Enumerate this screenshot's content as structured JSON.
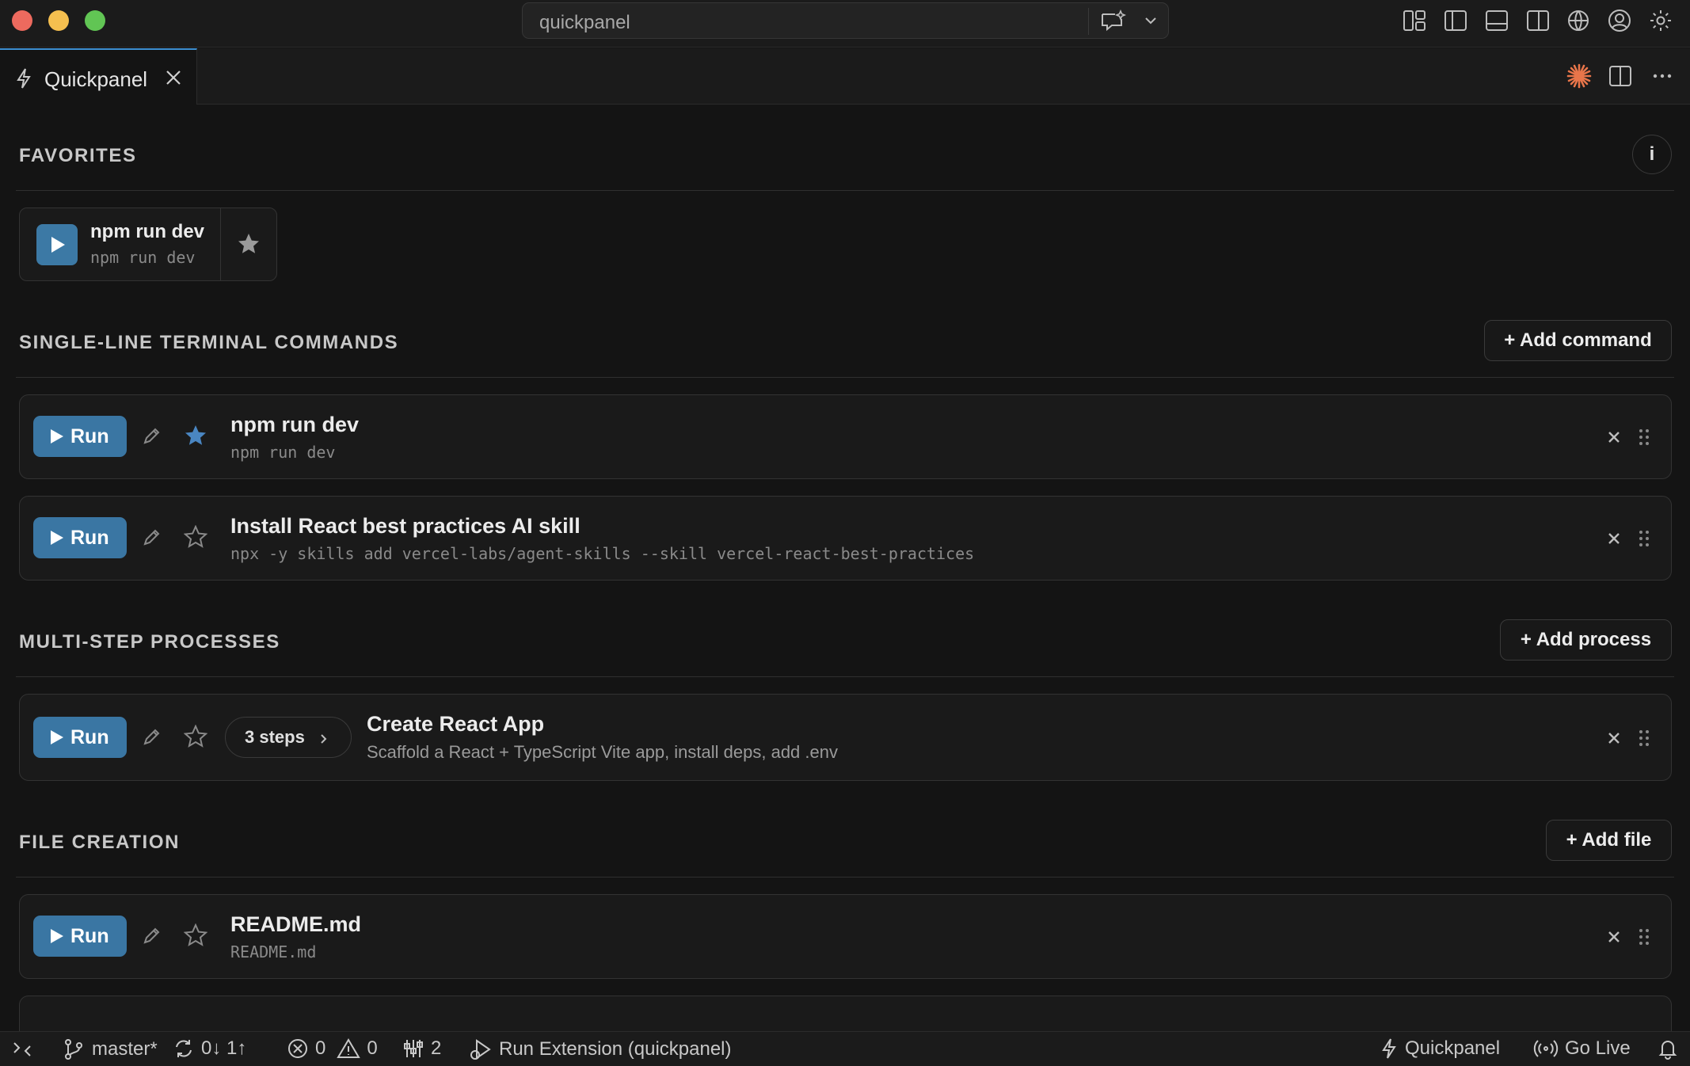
{
  "window": {
    "search_text": "quickpanel"
  },
  "tab": {
    "label": "Quickpanel"
  },
  "favorites": {
    "title": "FAVORITES",
    "info_label": "i",
    "items": [
      {
        "name": "npm run dev",
        "command": "npm run dev"
      }
    ]
  },
  "single_line": {
    "title": "SINGLE-LINE TERMINAL COMMANDS",
    "add_label": "+ Add command",
    "items": [
      {
        "run_label": "Run",
        "name": "npm run dev",
        "command": "npm run dev",
        "starred": true
      },
      {
        "run_label": "Run",
        "name": "Install React best practices AI skill",
        "command": "npx -y skills add vercel-labs/agent-skills --skill vercel-react-best-practices",
        "starred": false
      }
    ]
  },
  "multi_step": {
    "title": "MULTI-STEP PROCESSES",
    "add_label": "+ Add process",
    "items": [
      {
        "run_label": "Run",
        "steps_label": "3 steps",
        "name": "Create React App",
        "description": "Scaffold a React + TypeScript Vite app, install deps, add .env",
        "starred": false
      }
    ]
  },
  "file_creation": {
    "title": "FILE CREATION",
    "add_label": "+ Add file",
    "items": [
      {
        "run_label": "Run",
        "name": "README.md",
        "path": "README.md",
        "starred": false
      }
    ]
  },
  "status_bar": {
    "branch": "master*",
    "sync": "0↓ 1↑",
    "errors": "0",
    "warnings": "0",
    "ports": "2",
    "run_extension": "Run Extension (quickpanel)",
    "quickpanel": "Quickpanel",
    "go_live": "Go Live"
  },
  "colors": {
    "background": "#141414",
    "accent_blue": "#3a76a3",
    "star_blue": "#4a86c2",
    "sparkle_orange": "#e8754a"
  }
}
